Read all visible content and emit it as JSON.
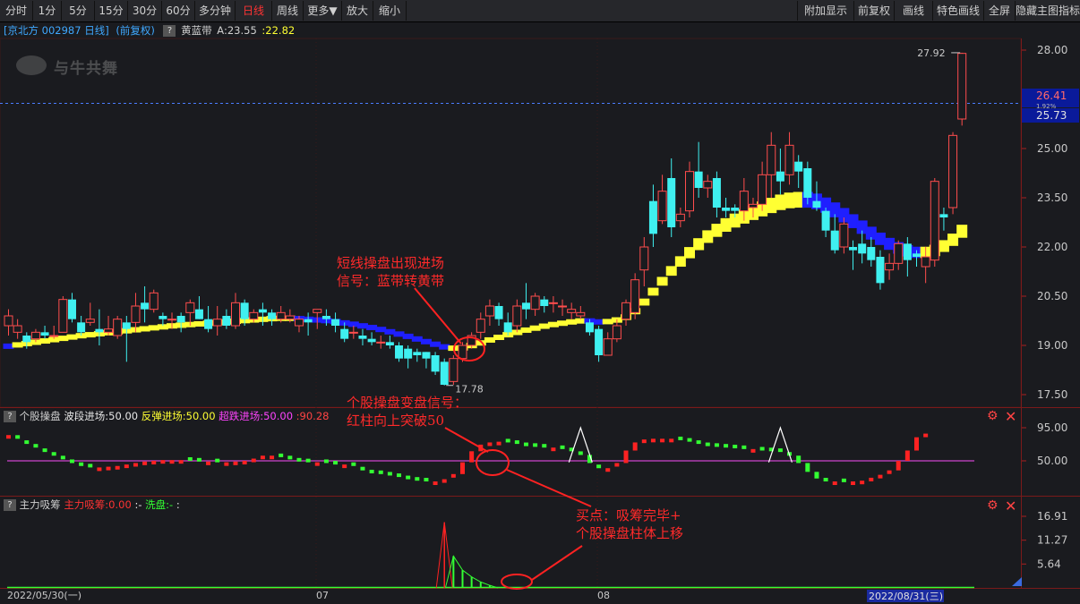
{
  "toolbar": {
    "left": [
      "分时",
      "1分",
      "5分",
      "15分",
      "30分",
      "60分",
      "多分钟",
      "日线",
      "周线",
      "更多▼",
      "放大",
      "缩小"
    ],
    "active": "日线",
    "right": [
      "附加显示",
      "前复权",
      "画线",
      "特色画线",
      "全屏",
      "隐藏主图指标"
    ]
  },
  "info": {
    "stock": "[京北方 002987 日线]",
    "adj": "(前复权)",
    "ind_name": "黄蓝带",
    "ind_a": "A:23.55",
    "ind_b": ":22.82"
  },
  "watermark": "与牛共舞",
  "price_axis": {
    "ticks": [
      "28.00",
      "25.00",
      "23.50",
      "22.00",
      "20.50",
      "19.00",
      "17.50"
    ],
    "last_price": "26.41",
    "price2": "25.73",
    "price_mid": "1.92%",
    "high_label": "27.92",
    "low_label": "17.78"
  },
  "panel2": {
    "name": "个股操盘",
    "l1": "波段进场:50.00",
    "l2": "反弹进场:50.00",
    "l3": "超跌进场:50.00",
    "l4": ":90.28",
    "ticks": [
      "95.00",
      "50.00"
    ]
  },
  "panel3": {
    "name": "主力吸筹",
    "l1": "主力吸筹:0.00",
    "l2": ":-",
    "l3": "洗盘:-",
    "l4": ":",
    "ticks": [
      "16.91",
      "11.27",
      "5.64"
    ]
  },
  "xaxis": {
    "start": "2022/05/30(一)",
    "m07": "07",
    "m08": "08",
    "end": "2022/08/31(三)"
  },
  "annotations": {
    "a1_l1": "短线操盘出现进场",
    "a1_l2": "信号：蓝带转黄带",
    "a2_l1": "个股操盘变盘信号：",
    "a2_l2": "红柱向上突破50",
    "a3_l1": "买点：吸筹完毕+",
    "a3_l2": "个股操盘柱体上移"
  },
  "colors": {
    "up": "#ff4d4d",
    "down": "#3ff0f0",
    "yellow": "#ffff33",
    "blue": "#1f1fff",
    "magenta": "#cc44cc",
    "green": "#33ff33",
    "red": "#ff2222"
  },
  "chart_data": {
    "type": "candlestick",
    "candles": [
      {
        "o": 19.6,
        "c": 19.9,
        "h": 20.1,
        "l": 19.3
      },
      {
        "o": 19.4,
        "c": 19.6,
        "h": 19.8,
        "l": 19.2
      },
      {
        "o": 19.3,
        "c": 19.1,
        "h": 19.4,
        "l": 18.9
      },
      {
        "o": 19.2,
        "c": 19.4,
        "h": 19.5,
        "l": 19.1
      },
      {
        "o": 19.4,
        "c": 19.3,
        "h": 19.6,
        "l": 19.2
      },
      {
        "o": 19.3,
        "c": 19.3,
        "h": 19.6,
        "l": 19.2
      },
      {
        "o": 19.4,
        "c": 20.4,
        "h": 20.5,
        "l": 19.4
      },
      {
        "o": 20.4,
        "c": 19.8,
        "h": 20.6,
        "l": 19.7
      },
      {
        "o": 19.7,
        "c": 19.4,
        "h": 19.9,
        "l": 19.3
      },
      {
        "o": 19.7,
        "c": 19.8,
        "h": 20.3,
        "l": 19.6
      },
      {
        "o": 19.5,
        "c": 19.4,
        "h": 20.1,
        "l": 19.0
      },
      {
        "o": 19.4,
        "c": 19.5,
        "h": 19.9,
        "l": 19.3
      },
      {
        "o": 19.3,
        "c": 19.8,
        "h": 19.9,
        "l": 19.2
      },
      {
        "o": 19.7,
        "c": 19.5,
        "h": 19.9,
        "l": 18.5
      },
      {
        "o": 19.7,
        "c": 20.2,
        "h": 20.6,
        "l": 19.4
      },
      {
        "o": 20.3,
        "c": 20.1,
        "h": 20.8,
        "l": 19.7
      },
      {
        "o": 20.1,
        "c": 20.6,
        "h": 20.7,
        "l": 20.0
      },
      {
        "o": 19.9,
        "c": 19.8,
        "h": 20.0,
        "l": 19.6
      },
      {
        "o": 19.8,
        "c": 19.8,
        "h": 20.0,
        "l": 19.5
      },
      {
        "o": 19.9,
        "c": 19.7,
        "h": 20.0,
        "l": 19.4
      },
      {
        "o": 20.0,
        "c": 20.3,
        "h": 20.4,
        "l": 19.6
      },
      {
        "o": 20.1,
        "c": 19.8,
        "h": 20.5,
        "l": 19.8
      },
      {
        "o": 19.8,
        "c": 19.5,
        "h": 20.2,
        "l": 19.4
      },
      {
        "o": 19.6,
        "c": 19.8,
        "h": 20.2,
        "l": 19.3
      },
      {
        "o": 19.9,
        "c": 19.6,
        "h": 20.1,
        "l": 19.5
      },
      {
        "o": 19.6,
        "c": 20.3,
        "h": 20.6,
        "l": 19.5
      },
      {
        "o": 20.3,
        "c": 19.8,
        "h": 20.4,
        "l": 19.6
      },
      {
        "o": 19.8,
        "c": 20.0,
        "h": 20.1,
        "l": 19.7
      },
      {
        "o": 20.1,
        "c": 20.0,
        "h": 20.3,
        "l": 19.6
      },
      {
        "o": 20.0,
        "c": 19.8,
        "h": 20.1,
        "l": 19.6
      },
      {
        "o": 19.8,
        "c": 20.0,
        "h": 20.2,
        "l": 19.7
      },
      {
        "o": 19.8,
        "c": 19.9,
        "h": 20.1,
        "l": 19.7
      },
      {
        "o": 19.6,
        "c": 19.8,
        "h": 19.9,
        "l": 19.4
      },
      {
        "o": 19.8,
        "c": 19.7,
        "h": 20.0,
        "l": 19.3
      },
      {
        "o": 20.0,
        "c": 20.1,
        "h": 20.1,
        "l": 19.5
      },
      {
        "o": 19.9,
        "c": 19.8,
        "h": 20.1,
        "l": 19.6
      },
      {
        "o": 19.8,
        "c": 19.6,
        "h": 20.0,
        "l": 19.4
      },
      {
        "o": 19.5,
        "c": 19.2,
        "h": 19.7,
        "l": 19.1
      },
      {
        "o": 19.4,
        "c": 19.4,
        "h": 19.6,
        "l": 19.2
      },
      {
        "o": 19.3,
        "c": 19.2,
        "h": 19.5,
        "l": 19.0
      },
      {
        "o": 19.2,
        "c": 19.1,
        "h": 19.4,
        "l": 19.0
      },
      {
        "o": 19.1,
        "c": 19.1,
        "h": 19.3,
        "l": 18.9
      },
      {
        "o": 19.1,
        "c": 19.0,
        "h": 19.3,
        "l": 18.9
      },
      {
        "o": 19.0,
        "c": 18.6,
        "h": 19.1,
        "l": 18.5
      },
      {
        "o": 18.9,
        "c": 18.6,
        "h": 19.0,
        "l": 18.3
      },
      {
        "o": 18.8,
        "c": 18.7,
        "h": 18.9,
        "l": 18.5
      },
      {
        "o": 18.8,
        "c": 18.6,
        "h": 18.8,
        "l": 18.3
      },
      {
        "o": 18.7,
        "c": 18.2,
        "h": 18.8,
        "l": 18.1
      },
      {
        "o": 18.5,
        "c": 17.8,
        "h": 18.6,
        "l": 17.78
      },
      {
        "o": 17.9,
        "c": 18.6,
        "h": 18.7,
        "l": 17.8
      },
      {
        "o": 18.6,
        "c": 19.0,
        "h": 19.1,
        "l": 18.5
      },
      {
        "o": 19.0,
        "c": 19.3,
        "h": 19.4,
        "l": 18.9
      },
      {
        "o": 19.4,
        "c": 19.8,
        "h": 20.0,
        "l": 19.2
      },
      {
        "o": 19.9,
        "c": 20.2,
        "h": 20.4,
        "l": 19.6
      },
      {
        "o": 20.2,
        "c": 19.8,
        "h": 20.3,
        "l": 19.6
      },
      {
        "o": 19.7,
        "c": 19.4,
        "h": 20.0,
        "l": 19.3
      },
      {
        "o": 19.6,
        "c": 20.2,
        "h": 20.4,
        "l": 19.4
      },
      {
        "o": 20.3,
        "c": 20.1,
        "h": 20.9,
        "l": 19.8
      },
      {
        "o": 20.1,
        "c": 20.5,
        "h": 20.6,
        "l": 19.9
      },
      {
        "o": 20.4,
        "c": 20.2,
        "h": 20.5,
        "l": 20.0
      },
      {
        "o": 20.3,
        "c": 20.3,
        "h": 20.5,
        "l": 20.0
      },
      {
        "o": 20.2,
        "c": 20.2,
        "h": 20.4,
        "l": 19.9
      },
      {
        "o": 20.0,
        "c": 20.1,
        "h": 20.3,
        "l": 19.8
      },
      {
        "o": 19.9,
        "c": 20.0,
        "h": 20.2,
        "l": 19.8
      },
      {
        "o": 19.7,
        "c": 19.4,
        "h": 19.8,
        "l": 19.3
      },
      {
        "o": 19.5,
        "c": 18.7,
        "h": 19.6,
        "l": 18.5
      },
      {
        "o": 18.7,
        "c": 19.2,
        "h": 19.4,
        "l": 18.7
      },
      {
        "o": 19.2,
        "c": 19.6,
        "h": 19.8,
        "l": 19.1
      },
      {
        "o": 19.8,
        "c": 20.3,
        "h": 20.4,
        "l": 19.6
      },
      {
        "o": 20.0,
        "c": 21.0,
        "h": 21.2,
        "l": 19.8
      },
      {
        "o": 21.3,
        "c": 22.0,
        "h": 22.3,
        "l": 20.8
      },
      {
        "o": 23.4,
        "c": 22.4,
        "h": 23.9,
        "l": 22.0
      },
      {
        "o": 22.8,
        "c": 23.7,
        "h": 24.2,
        "l": 22.7
      },
      {
        "o": 24.1,
        "c": 22.6,
        "h": 24.7,
        "l": 22.3
      },
      {
        "o": 22.8,
        "c": 23.0,
        "h": 23.2,
        "l": 22.6
      },
      {
        "o": 23.1,
        "c": 24.3,
        "h": 24.6,
        "l": 22.9
      },
      {
        "o": 24.3,
        "c": 23.8,
        "h": 25.2,
        "l": 23.5
      },
      {
        "o": 23.8,
        "c": 24.0,
        "h": 24.2,
        "l": 23.5
      },
      {
        "o": 24.1,
        "c": 23.2,
        "h": 24.3,
        "l": 22.9
      },
      {
        "o": 23.2,
        "c": 23.1,
        "h": 23.5,
        "l": 22.9
      },
      {
        "o": 23.2,
        "c": 23.1,
        "h": 23.3,
        "l": 22.9
      },
      {
        "o": 23.1,
        "c": 23.7,
        "h": 24.1,
        "l": 22.8
      },
      {
        "o": 23.2,
        "c": 23.3,
        "h": 23.5,
        "l": 22.9
      },
      {
        "o": 23.3,
        "c": 24.2,
        "h": 24.6,
        "l": 23.1
      },
      {
        "o": 24.2,
        "c": 25.1,
        "h": 25.5,
        "l": 23.5
      },
      {
        "o": 24.3,
        "c": 24.0,
        "h": 25.0,
        "l": 23.6
      },
      {
        "o": 24.2,
        "c": 25.1,
        "h": 25.5,
        "l": 23.9
      },
      {
        "o": 24.6,
        "c": 24.3,
        "h": 24.8,
        "l": 23.8
      },
      {
        "o": 24.4,
        "c": 23.5,
        "h": 24.6,
        "l": 23.3
      },
      {
        "o": 23.4,
        "c": 23.2,
        "h": 24.0,
        "l": 23.1
      },
      {
        "o": 23.1,
        "c": 22.5,
        "h": 23.2,
        "l": 22.3
      },
      {
        "o": 22.5,
        "c": 21.9,
        "h": 23.0,
        "l": 21.8
      },
      {
        "o": 22.0,
        "c": 22.7,
        "h": 22.9,
        "l": 21.8
      },
      {
        "o": 22.0,
        "c": 21.9,
        "h": 22.2,
        "l": 21.3
      },
      {
        "o": 22.1,
        "c": 21.8,
        "h": 22.5,
        "l": 21.5
      },
      {
        "o": 22.0,
        "c": 21.6,
        "h": 22.3,
        "l": 21.4
      },
      {
        "o": 21.7,
        "c": 20.9,
        "h": 21.9,
        "l": 20.7
      },
      {
        "o": 21.3,
        "c": 21.5,
        "h": 21.8,
        "l": 21.0
      },
      {
        "o": 21.5,
        "c": 22.1,
        "h": 22.2,
        "l": 21.3
      },
      {
        "o": 22.1,
        "c": 21.6,
        "h": 22.3,
        "l": 21.1
      },
      {
        "o": 21.8,
        "c": 21.7,
        "h": 21.9,
        "l": 21.4
      },
      {
        "o": 21.4,
        "c": 21.7,
        "h": 22.0,
        "l": 20.9
      },
      {
        "o": 21.6,
        "c": 24.0,
        "h": 24.1,
        "l": 21.4
      },
      {
        "o": 23.0,
        "c": 22.9,
        "h": 23.2,
        "l": 22.5
      },
      {
        "o": 23.2,
        "c": 25.4,
        "h": 25.5,
        "l": 23.0
      },
      {
        "o": 25.9,
        "c": 27.9,
        "h": 27.92,
        "l": 25.7
      }
    ],
    "band": [
      19.03,
      19.07,
      19.11,
      19.15,
      19.19,
      19.23,
      19.27,
      19.31,
      19.35,
      19.38,
      19.41,
      19.44,
      19.47,
      19.5,
      19.53,
      19.56,
      19.59,
      19.62,
      19.65,
      19.67,
      19.69,
      19.71,
      19.73,
      19.75,
      19.77,
      19.79,
      19.81,
      19.83,
      19.85,
      19.87,
      19.88,
      19.88,
      19.87,
      19.85,
      19.83,
      19.81,
      19.78,
      19.74,
      19.7,
      19.65,
      19.6,
      19.54,
      19.47,
      19.4,
      19.33,
      19.25,
      19.17,
      19.09,
      19.01,
      18.97,
      18.98,
      19.05,
      19.13,
      19.22,
      19.3,
      19.38,
      19.45,
      19.52,
      19.58,
      19.64,
      19.69,
      19.73,
      19.77,
      19.8,
      19.8,
      19.77,
      19.78,
      19.83,
      19.92,
      20.11,
      20.4,
      20.73,
      21.06,
      21.39,
      21.69,
      21.97,
      22.24,
      22.48,
      22.68,
      22.85,
      22.99,
      23.12,
      23.24,
      23.36,
      23.47,
      23.57,
      23.63,
      23.65,
      23.65,
      23.6,
      23.48,
      23.33,
      23.16,
      22.97,
      22.78,
      22.59,
      22.41,
      22.25,
      22.12,
      22.03,
      21.98,
      21.98,
      22.04,
      22.18,
      22.38,
      22.65,
      22.99
    ],
    "band_color": [
      "b",
      "y",
      "y",
      "y",
      "y",
      "y",
      "y",
      "y",
      "y",
      "y",
      "y",
      "y",
      "y",
      "y",
      "y",
      "y",
      "y",
      "y",
      "y",
      "y",
      "y",
      "y",
      "y",
      "y",
      "y",
      "y",
      "y",
      "y",
      "y",
      "y",
      "y",
      "y",
      "b",
      "b",
      "b",
      "b",
      "b",
      "b",
      "b",
      "b",
      "b",
      "b",
      "b",
      "b",
      "b",
      "b",
      "b",
      "b",
      "b",
      "y",
      "y",
      "y",
      "y",
      "y",
      "y",
      "y",
      "y",
      "y",
      "y",
      "y",
      "y",
      "y",
      "y",
      "y",
      "b",
      "b",
      "y",
      "y",
      "y",
      "y",
      "y",
      "y",
      "y",
      "y",
      "y",
      "y",
      "y",
      "y",
      "y",
      "y",
      "y",
      "y",
      "y",
      "y",
      "y",
      "y",
      "y",
      "y",
      "b",
      "b",
      "b",
      "b",
      "b",
      "b",
      "b",
      "b",
      "b",
      "b",
      "b",
      "b",
      "b",
      "y",
      "y",
      "y",
      "y",
      "y",
      "y"
    ],
    "osc": [
      85,
      80,
      73,
      68,
      62,
      57,
      52,
      47,
      43,
      41,
      41,
      42,
      43,
      45,
      47,
      49,
      50,
      51,
      51,
      51,
      50,
      49,
      49,
      48,
      48,
      49,
      50,
      53,
      57,
      57,
      55,
      52,
      49,
      48,
      48,
      47,
      45,
      45,
      43,
      37,
      33,
      32,
      30,
      28,
      25,
      23,
      22,
      22,
      25,
      32,
      48,
      63,
      72,
      75,
      76,
      75,
      73,
      70,
      69,
      68,
      68,
      66,
      63,
      58,
      47,
      40,
      40,
      47,
      64,
      75,
      79,
      80,
      80,
      80,
      78,
      76,
      73,
      70,
      69,
      68,
      67,
      66,
      66,
      64,
      63,
      62,
      57,
      47,
      35,
      26,
      22,
      22,
      21,
      22,
      23,
      27,
      31,
      37,
      50,
      64,
      82,
      87
    ],
    "osc_tri": [
      {
        "i": 63,
        "p": 75
      },
      {
        "i": 85,
        "p": 75
      }
    ],
    "mf": [
      0,
      0,
      0,
      0,
      0,
      0,
      0,
      0,
      0,
      0,
      0,
      0,
      0,
      0,
      0,
      0,
      0,
      0,
      0,
      0,
      0,
      0,
      0,
      0,
      0,
      0,
      0,
      0,
      0,
      0,
      0,
      0,
      0,
      0,
      0,
      0,
      0,
      0,
      0,
      0,
      0,
      0,
      0,
      0,
      0,
      0,
      0,
      0,
      0,
      0,
      0,
      0,
      0,
      0,
      0,
      0,
      0,
      0,
      0,
      0,
      0,
      0,
      0,
      0,
      0,
      0,
      0,
      0,
      0,
      0,
      0,
      0,
      0,
      0,
      0,
      0,
      0,
      0,
      0,
      0,
      0,
      0,
      0,
      0,
      0,
      0,
      0,
      0,
      0,
      0,
      0,
      0,
      0,
      0,
      0,
      0,
      0,
      0,
      0,
      0,
      0,
      0,
      0,
      0,
      0,
      0,
      0
    ],
    "mf_red_spike": {
      "i": 48,
      "v": 15.5
    },
    "mf_green_spike": [
      {
        "i": 49,
        "v": 7.5
      },
      {
        "i": 50,
        "v": 4.2
      },
      {
        "i": 51,
        "v": 2.6
      },
      {
        "i": 52,
        "v": 1.4
      },
      {
        "i": 53,
        "v": 0.6
      }
    ]
  }
}
